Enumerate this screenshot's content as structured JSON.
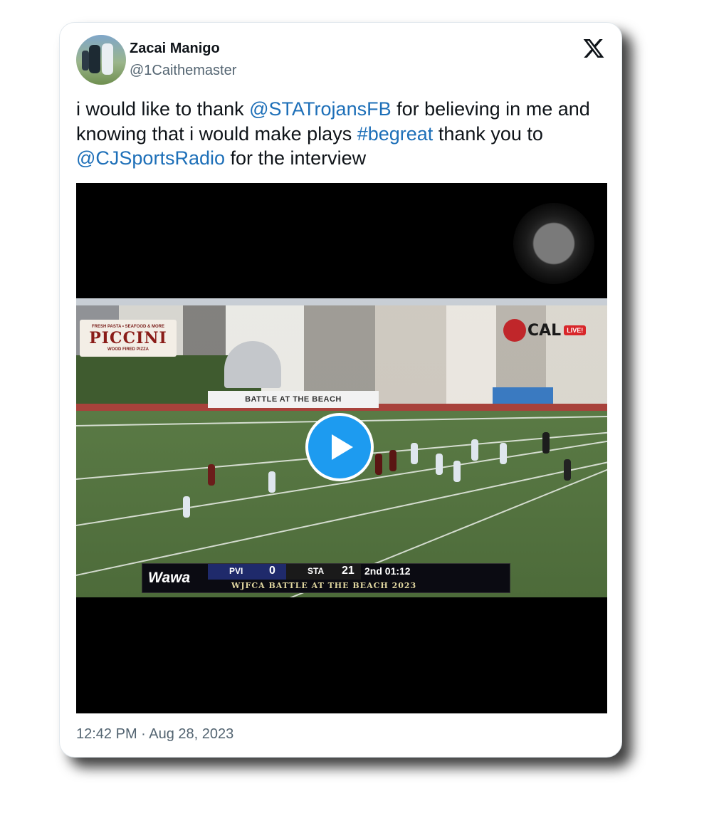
{
  "tweet": {
    "author_name": "Zacai Manigo",
    "author_handle": "@1Caithemaster",
    "text_parts": [
      {
        "text": "i would like to thank ",
        "type": "plain"
      },
      {
        "text": "@STATrojansFB",
        "type": "link"
      },
      {
        "text": " for believing in me and knowing that i would make plays ",
        "type": "plain"
      },
      {
        "text": "#begreat",
        "type": "link"
      },
      {
        "text": " thank you to ",
        "type": "plain"
      },
      {
        "text": "@CJSportsRadio",
        "type": "link"
      },
      {
        "text": " for the interview",
        "type": "plain"
      }
    ],
    "timestamp": "12:42 PM · Aug 28, 2023"
  },
  "video": {
    "banner_text": "BATTLE AT THE BEACH",
    "sponsor_top": "FRESH PASTA • SEAFOOD & MORE",
    "sponsor_name": "PICCINI",
    "sponsor_sub": "WOOD FIRED PIZZA",
    "network_logo": "CAL",
    "network_badge": "LIVE!",
    "scorebug": {
      "sponsor": "Wawa",
      "team1": "PVI",
      "score1": "0",
      "team2": "STA",
      "score2": "21",
      "clock": "2nd 01:12",
      "event": "WJFCA BATTLE AT THE BEACH 2023"
    }
  },
  "icons": {
    "logo": "x-logo-icon",
    "play": "play-icon",
    "record": "record-icon"
  },
  "colors": {
    "link": "#1d6fb8",
    "play_button": "#1d9bf0",
    "secondary_text": "#536471"
  }
}
